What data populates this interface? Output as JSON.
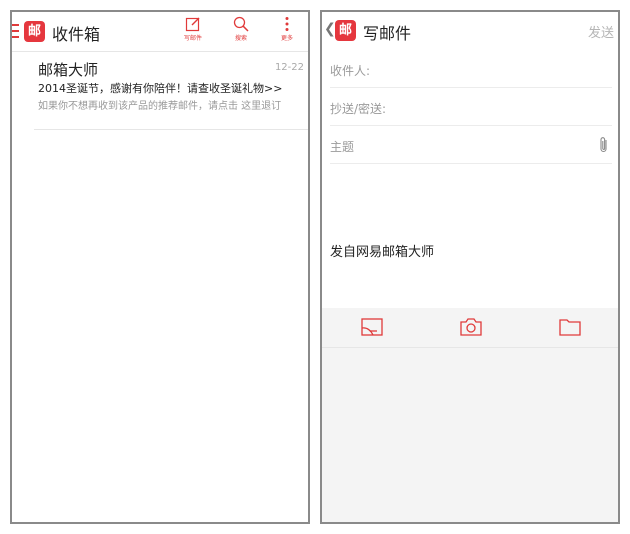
{
  "colors": {
    "accent": "#e03a3a",
    "logo_bg": "#e5373e",
    "frame": "#8a8a8a"
  },
  "inbox": {
    "logo_text": "邮",
    "title": "收件箱",
    "toolbar": {
      "compose_label": "写邮件",
      "search_label": "搜索",
      "more_label": "更多"
    },
    "mail": {
      "sender": "邮箱大师",
      "date": "12-22",
      "subject": "2014圣诞节，感谢有你陪伴！请查收圣诞礼物>>",
      "preview": "如果你不想再收到该产品的推荐邮件，请点击 这里退订"
    }
  },
  "compose": {
    "back_icon": "chevron-left-icon",
    "logo_text": "邮",
    "title": "写邮件",
    "send_label": "发送",
    "to_label": "收件人:",
    "cc_label": "抄送/密送:",
    "subject_label": "主题",
    "signature": "发自网易邮箱大师",
    "bottom_icons": [
      "image-icon",
      "camera-icon",
      "folder-icon"
    ]
  }
}
